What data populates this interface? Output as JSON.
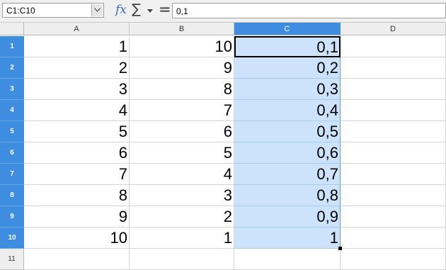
{
  "formula_bar": {
    "name_box": "C1:C10",
    "function_wizard_label": "fx",
    "sum_symbol": "∑",
    "equals_symbol": "=",
    "formula_value": "0,1"
  },
  "columns": [
    {
      "label": "A",
      "selected": false
    },
    {
      "label": "B",
      "selected": false
    },
    {
      "label": "C",
      "selected": true
    },
    {
      "label": "D",
      "selected": false
    }
  ],
  "rows": [
    {
      "num": "1",
      "A": "1",
      "B": "10",
      "C": "0,1"
    },
    {
      "num": "2",
      "A": "2",
      "B": "9",
      "C": "0,2"
    },
    {
      "num": "3",
      "A": "3",
      "B": "8",
      "C": "0,3"
    },
    {
      "num": "4",
      "A": "4",
      "B": "7",
      "C": "0,4"
    },
    {
      "num": "5",
      "A": "5",
      "B": "6",
      "C": "0,5"
    },
    {
      "num": "6",
      "A": "6",
      "B": "5",
      "C": "0,6"
    },
    {
      "num": "7",
      "A": "7",
      "B": "4",
      "C": "0,7"
    },
    {
      "num": "8",
      "A": "8",
      "B": "3",
      "C": "0,8"
    },
    {
      "num": "9",
      "A": "9",
      "B": "2",
      "C": "0,9"
    },
    {
      "num": "10",
      "A": "10",
      "B": "1",
      "C": "1"
    },
    {
      "num": "11",
      "A": "",
      "B": "",
      "C": ""
    }
  ],
  "selection": {
    "range": "C1:C10",
    "active_cell": "C1"
  },
  "colors": {
    "selection_header": "#3e8de0",
    "selection_fill": "#cce3fb",
    "header_bg": "#eeeeee"
  }
}
